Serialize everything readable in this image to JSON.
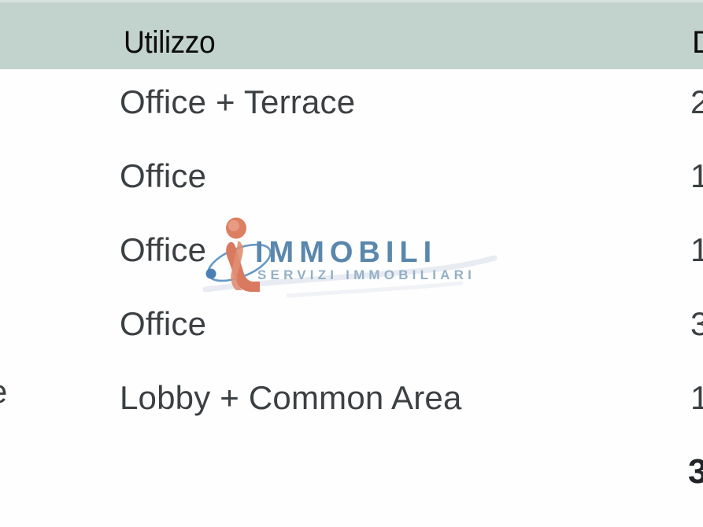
{
  "table": {
    "header": {
      "usage_label": "Utilizzo",
      "amount_label": "D",
      "background_color": "#c2d2cc",
      "text_color": "#0d0d0d"
    },
    "left_clipped_fragment": "e",
    "rows": [
      {
        "usage": "Office + Terrace",
        "amount": "2"
      },
      {
        "usage": "Office",
        "amount": "1"
      },
      {
        "usage": "Office",
        "amount": "1"
      },
      {
        "usage": "Office",
        "amount": "3"
      },
      {
        "usage": "Lobby + Common Area",
        "amount": "1"
      }
    ],
    "total": {
      "amount": "3"
    }
  },
  "watermark": {
    "wordmark": "IMMOBILI",
    "tagline": "SERVIZI IMMOBILIARI",
    "wordmark_color": "#5a87ac",
    "tagline_color": "#93b0c6",
    "mark_color": "#d9795f",
    "mark_accent_color": "#4a7fb5"
  }
}
